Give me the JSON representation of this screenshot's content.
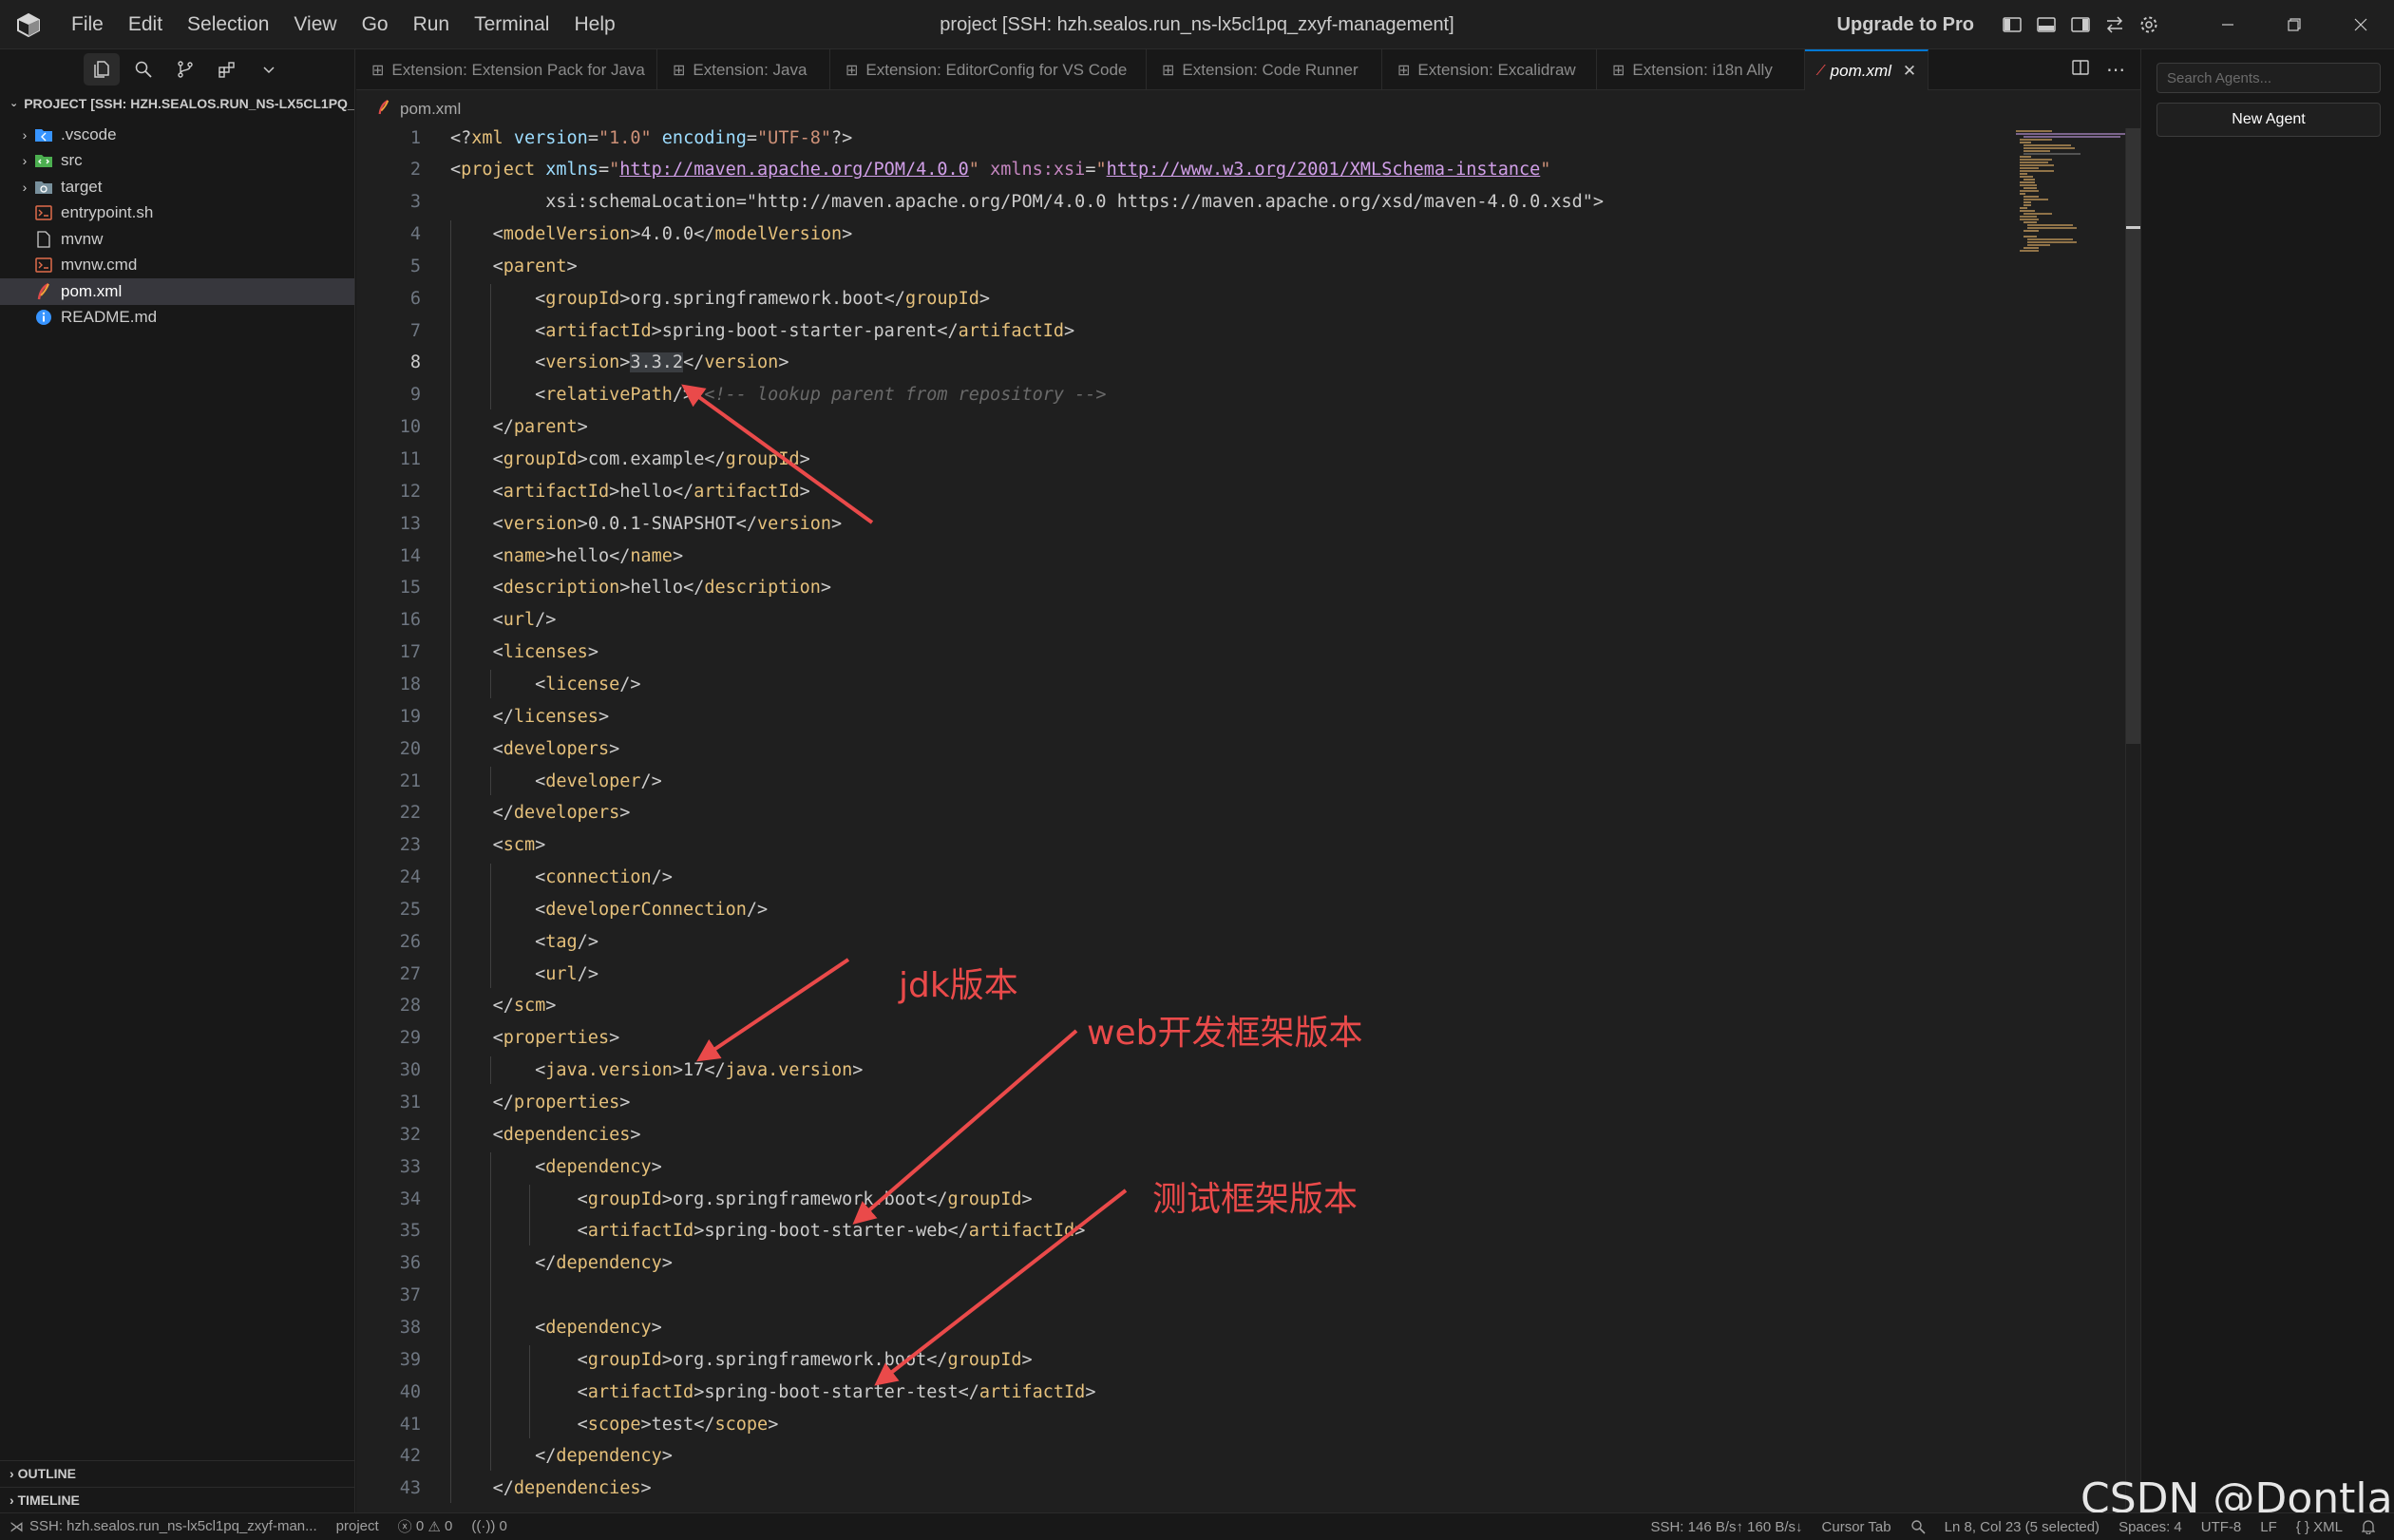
{
  "titlebar": {
    "menu": [
      "File",
      "Edit",
      "Selection",
      "View",
      "Go",
      "Run",
      "Terminal",
      "Help"
    ],
    "title": "project [SSH: hzh.sealos.run_ns-lx5cl1pq_zxyf-management]",
    "upgrade_label": "Upgrade to Pro"
  },
  "sidebar": {
    "explorer_title": "PROJECT [SSH: HZH.SEALOS.RUN_NS-LX5CL1PQ_ZX...",
    "items": [
      {
        "label": ".vscode",
        "kind": "folder",
        "icon": "vscode-folder-icon",
        "color": "#3794ff"
      },
      {
        "label": "src",
        "kind": "folder",
        "icon": "src-folder-icon",
        "color": "#4caf50"
      },
      {
        "label": "target",
        "kind": "folder",
        "icon": "target-folder-icon",
        "color": "#78909c"
      },
      {
        "label": "entrypoint.sh",
        "kind": "file",
        "icon": "shell-file-icon",
        "color": "#e06c4a"
      },
      {
        "label": "mvnw",
        "kind": "file",
        "icon": "file-icon",
        "color": "#cccccc"
      },
      {
        "label": "mvnw.cmd",
        "kind": "file",
        "icon": "cmd-file-icon",
        "color": "#e06c4a"
      },
      {
        "label": "pom.xml",
        "kind": "file",
        "icon": "maven-file-icon",
        "color": "#e04a4a"
      },
      {
        "label": "README.md",
        "kind": "file",
        "icon": "info-file-icon",
        "color": "#3794ff"
      }
    ],
    "outline_label": "OUTLINE",
    "timeline_label": "TIMELINE"
  },
  "tabs": [
    {
      "label": "Extension: Extension Pack for Java",
      "active": false
    },
    {
      "label": "Extension: Java",
      "active": false
    },
    {
      "label": "Extension: EditorConfig for VS Code",
      "active": false
    },
    {
      "label": "Extension: Code Runner",
      "active": false
    },
    {
      "label": "Extension: Excalidraw",
      "active": false
    },
    {
      "label": "Extension: i18n Ally",
      "active": false
    },
    {
      "label": "pom.xml",
      "active": true
    }
  ],
  "breadcrumb": "pom.xml",
  "editor": {
    "current_line": 8,
    "lines": [
      {
        "n": "1",
        "text": "<?xml version=\"1.0\" encoding=\"UTF-8\"?>"
      },
      {
        "n": "2",
        "text": "<project xmlns=\"http://maven.apache.org/POM/4.0.0\" xmlns:xsi=\"http://www.w3.org/2001/XMLSchema-instance\""
      },
      {
        "n": "3",
        "text": "         xsi:schemaLocation=\"http://maven.apache.org/POM/4.0.0 https://maven.apache.org/xsd/maven-4.0.0.xsd\">"
      },
      {
        "n": "4",
        "text": "    <modelVersion>4.0.0</modelVersion>"
      },
      {
        "n": "5",
        "text": "    <parent>"
      },
      {
        "n": "6",
        "text": "        <groupId>org.springframework.boot</groupId>"
      },
      {
        "n": "7",
        "text": "        <artifactId>spring-boot-starter-parent</artifactId>"
      },
      {
        "n": "8",
        "text": "        <version>3.3.2</version>"
      },
      {
        "n": "9",
        "text": "        <relativePath/> <!-- lookup parent from repository -->"
      },
      {
        "n": "10",
        "text": "    </parent>"
      },
      {
        "n": "11",
        "text": "    <groupId>com.example</groupId>"
      },
      {
        "n": "12",
        "text": "    <artifactId>hello</artifactId>"
      },
      {
        "n": "13",
        "text": "    <version>0.0.1-SNAPSHOT</version>"
      },
      {
        "n": "14",
        "text": "    <name>hello</name>"
      },
      {
        "n": "15",
        "text": "    <description>hello</description>"
      },
      {
        "n": "16",
        "text": "    <url/>"
      },
      {
        "n": "17",
        "text": "    <licenses>"
      },
      {
        "n": "18",
        "text": "        <license/>"
      },
      {
        "n": "19",
        "text": "    </licenses>"
      },
      {
        "n": "20",
        "text": "    <developers>"
      },
      {
        "n": "21",
        "text": "        <developer/>"
      },
      {
        "n": "22",
        "text": "    </developers>"
      },
      {
        "n": "23",
        "text": "    <scm>"
      },
      {
        "n": "24",
        "text": "        <connection/>"
      },
      {
        "n": "25",
        "text": "        <developerConnection/>"
      },
      {
        "n": "26",
        "text": "        <tag/>"
      },
      {
        "n": "27",
        "text": "        <url/>"
      },
      {
        "n": "28",
        "text": "    </scm>"
      },
      {
        "n": "29",
        "text": "    <properties>"
      },
      {
        "n": "30",
        "text": "        <java.version>17</java.version>"
      },
      {
        "n": "31",
        "text": "    </properties>"
      },
      {
        "n": "32",
        "text": "    <dependencies>"
      },
      {
        "n": "33",
        "text": "        <dependency>"
      },
      {
        "n": "34",
        "text": "            <groupId>org.springframework.boot</groupId>"
      },
      {
        "n": "35",
        "text": "            <artifactId>spring-boot-starter-web</artifactId>"
      },
      {
        "n": "36",
        "text": "        </dependency>"
      },
      {
        "n": "37",
        "text": ""
      },
      {
        "n": "38",
        "text": "        <dependency>"
      },
      {
        "n": "39",
        "text": "            <groupId>org.springframework.boot</groupId>"
      },
      {
        "n": "40",
        "text": "            <artifactId>spring-boot-starter-test</artifactId>"
      },
      {
        "n": "41",
        "text": "            <scope>test</scope>"
      },
      {
        "n": "42",
        "text": "        </dependency>"
      },
      {
        "n": "43",
        "text": "    </dependencies>"
      }
    ]
  },
  "agents": {
    "search_placeholder": "Search Agents...",
    "new_agent_label": "New Agent"
  },
  "statusbar": {
    "remote": "SSH: hzh.sealos.run_ns-lx5cl1pq_zxyf-man...",
    "folder": "project",
    "errors": "0",
    "warnings": "0",
    "ports": "0",
    "ssh_traffic": "SSH: 146 B/s↑ 160 B/s↓",
    "cursor_tab": "Cursor Tab",
    "position": "Ln 8, Col 23 (5 selected)",
    "spaces": "Spaces: 4",
    "encoding": "UTF-8",
    "eol": "LF",
    "language": "XML"
  },
  "annotations": {
    "jdk": "jdk版本",
    "web": "web开发框架版本",
    "test": "测试框架版本",
    "color": "#ea4a4a"
  },
  "watermark": "CSDN @Dontla"
}
